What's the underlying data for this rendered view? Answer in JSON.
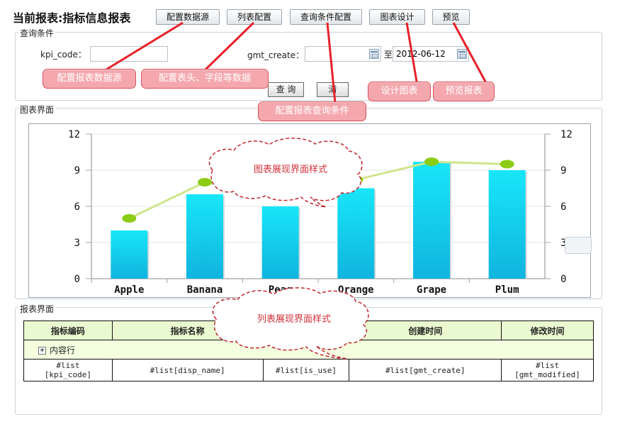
{
  "page_title": "当前报表:指标信息报表",
  "toolbar": {
    "datasource": "配置数据源",
    "list_config": "列表配置",
    "query_config": "查询条件配置",
    "chart_design": "图表设计",
    "preview": "预览"
  },
  "query_panel": {
    "legend": "查询条件",
    "kpi_code_label": "kpi_code：",
    "kpi_code_value": "",
    "gmt_create_label": "gmt_create：",
    "gmt_create_from": "",
    "range_sep": "至",
    "gmt_create_to": "2012-06-12",
    "query_button": "查 询",
    "clear_button": "清"
  },
  "callouts": {
    "datasource": "配置报表数据源",
    "list": "配置表头、字段等数据",
    "query": "配置报表查询条件",
    "chart": "设计图表",
    "preview": "预览报表",
    "chart_style": "图表展现界面样式",
    "list_style": "列表展现界面样式"
  },
  "chart_panel": {
    "legend": "图表界面"
  },
  "chart_data": {
    "type": "bar",
    "categories": [
      "Apple",
      "Banana",
      "Pear",
      "Orange",
      "Grape",
      "Plum"
    ],
    "series": [
      {
        "values": [
          4,
          7,
          6,
          7.5,
          9.7,
          9
        ],
        "kind": "bar"
      },
      {
        "values": [
          5,
          8,
          7,
          8.2,
          9.7,
          9.5
        ],
        "kind": "line"
      }
    ],
    "ylim": [
      0,
      12
    ],
    "y_ticks": [
      0,
      3,
      6,
      9,
      12
    ],
    "grid": true,
    "colors": {
      "bar": "#1ed0f0",
      "line": "#9acd32"
    }
  },
  "report_panel": {
    "legend": "报表界面",
    "headers": [
      "指标编码",
      "指标名称",
      "",
      "创建时间",
      "修改时间"
    ],
    "group_row": "内容行",
    "row": [
      "#list\n[kpi_code]",
      "#list[disp_name]",
      "#list[is_use]",
      "#list[gmt_create]",
      "#list\n[gmt_modified]"
    ]
  }
}
